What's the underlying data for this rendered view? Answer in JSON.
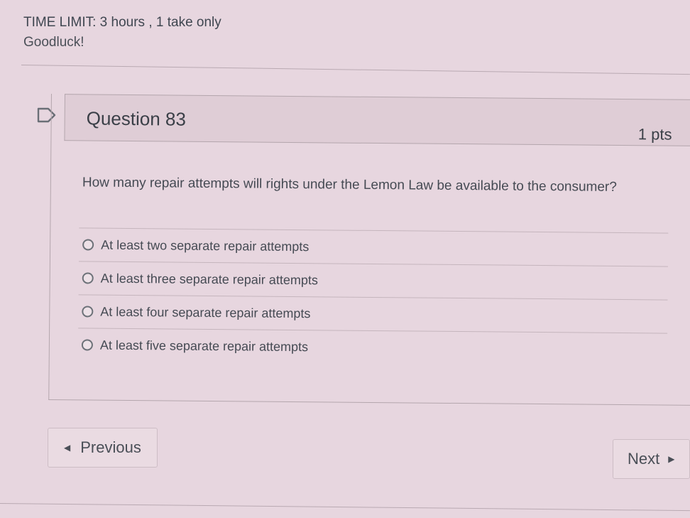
{
  "header": {
    "time_limit": "TIME LIMIT: 3 hours , 1 take only",
    "note": "Goodluck!"
  },
  "question": {
    "title": "Question 83",
    "points": "1 pts",
    "text": "How many repair attempts will rights under the Lemon Law be available to the consumer?",
    "answers": [
      "At least two separate repair attempts",
      "At least three separate repair attempts",
      "At least four separate repair attempts",
      "At least five separate repair attempts"
    ]
  },
  "nav": {
    "previous_label": "Previous",
    "next_label": "Next"
  }
}
